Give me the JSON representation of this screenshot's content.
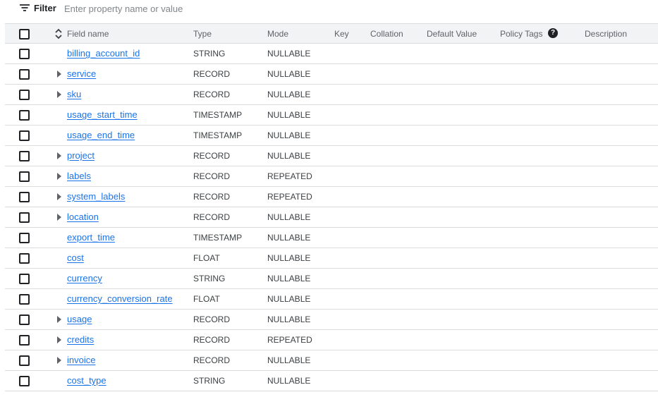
{
  "filter": {
    "label": "Filter",
    "placeholder": "Enter property name or value",
    "icon": "filter-list-icon"
  },
  "columns": {
    "field_name": "Field name",
    "type": "Type",
    "mode": "Mode",
    "key": "Key",
    "collation": "Collation",
    "default_value": "Default Value",
    "policy_tags": "Policy Tags",
    "description": "Description"
  },
  "rows": [
    {
      "name": "billing_account_id",
      "type": "STRING",
      "mode": "NULLABLE",
      "expandable": false
    },
    {
      "name": "service",
      "type": "RECORD",
      "mode": "NULLABLE",
      "expandable": true
    },
    {
      "name": "sku",
      "type": "RECORD",
      "mode": "NULLABLE",
      "expandable": true
    },
    {
      "name": "usage_start_time",
      "type": "TIMESTAMP",
      "mode": "NULLABLE",
      "expandable": false
    },
    {
      "name": "usage_end_time",
      "type": "TIMESTAMP",
      "mode": "NULLABLE",
      "expandable": false
    },
    {
      "name": "project",
      "type": "RECORD",
      "mode": "NULLABLE",
      "expandable": true
    },
    {
      "name": "labels",
      "type": "RECORD",
      "mode": "REPEATED",
      "expandable": true
    },
    {
      "name": "system_labels",
      "type": "RECORD",
      "mode": "REPEATED",
      "expandable": true
    },
    {
      "name": "location",
      "type": "RECORD",
      "mode": "NULLABLE",
      "expandable": true
    },
    {
      "name": "export_time",
      "type": "TIMESTAMP",
      "mode": "NULLABLE",
      "expandable": false
    },
    {
      "name": "cost",
      "type": "FLOAT",
      "mode": "NULLABLE",
      "expandable": false
    },
    {
      "name": "currency",
      "type": "STRING",
      "mode": "NULLABLE",
      "expandable": false
    },
    {
      "name": "currency_conversion_rate",
      "type": "FLOAT",
      "mode": "NULLABLE",
      "expandable": false
    },
    {
      "name": "usage",
      "type": "RECORD",
      "mode": "NULLABLE",
      "expandable": true
    },
    {
      "name": "credits",
      "type": "RECORD",
      "mode": "REPEATED",
      "expandable": true
    },
    {
      "name": "invoice",
      "type": "RECORD",
      "mode": "NULLABLE",
      "expandable": true
    },
    {
      "name": "cost_type",
      "type": "STRING",
      "mode": "NULLABLE",
      "expandable": false
    }
  ]
}
